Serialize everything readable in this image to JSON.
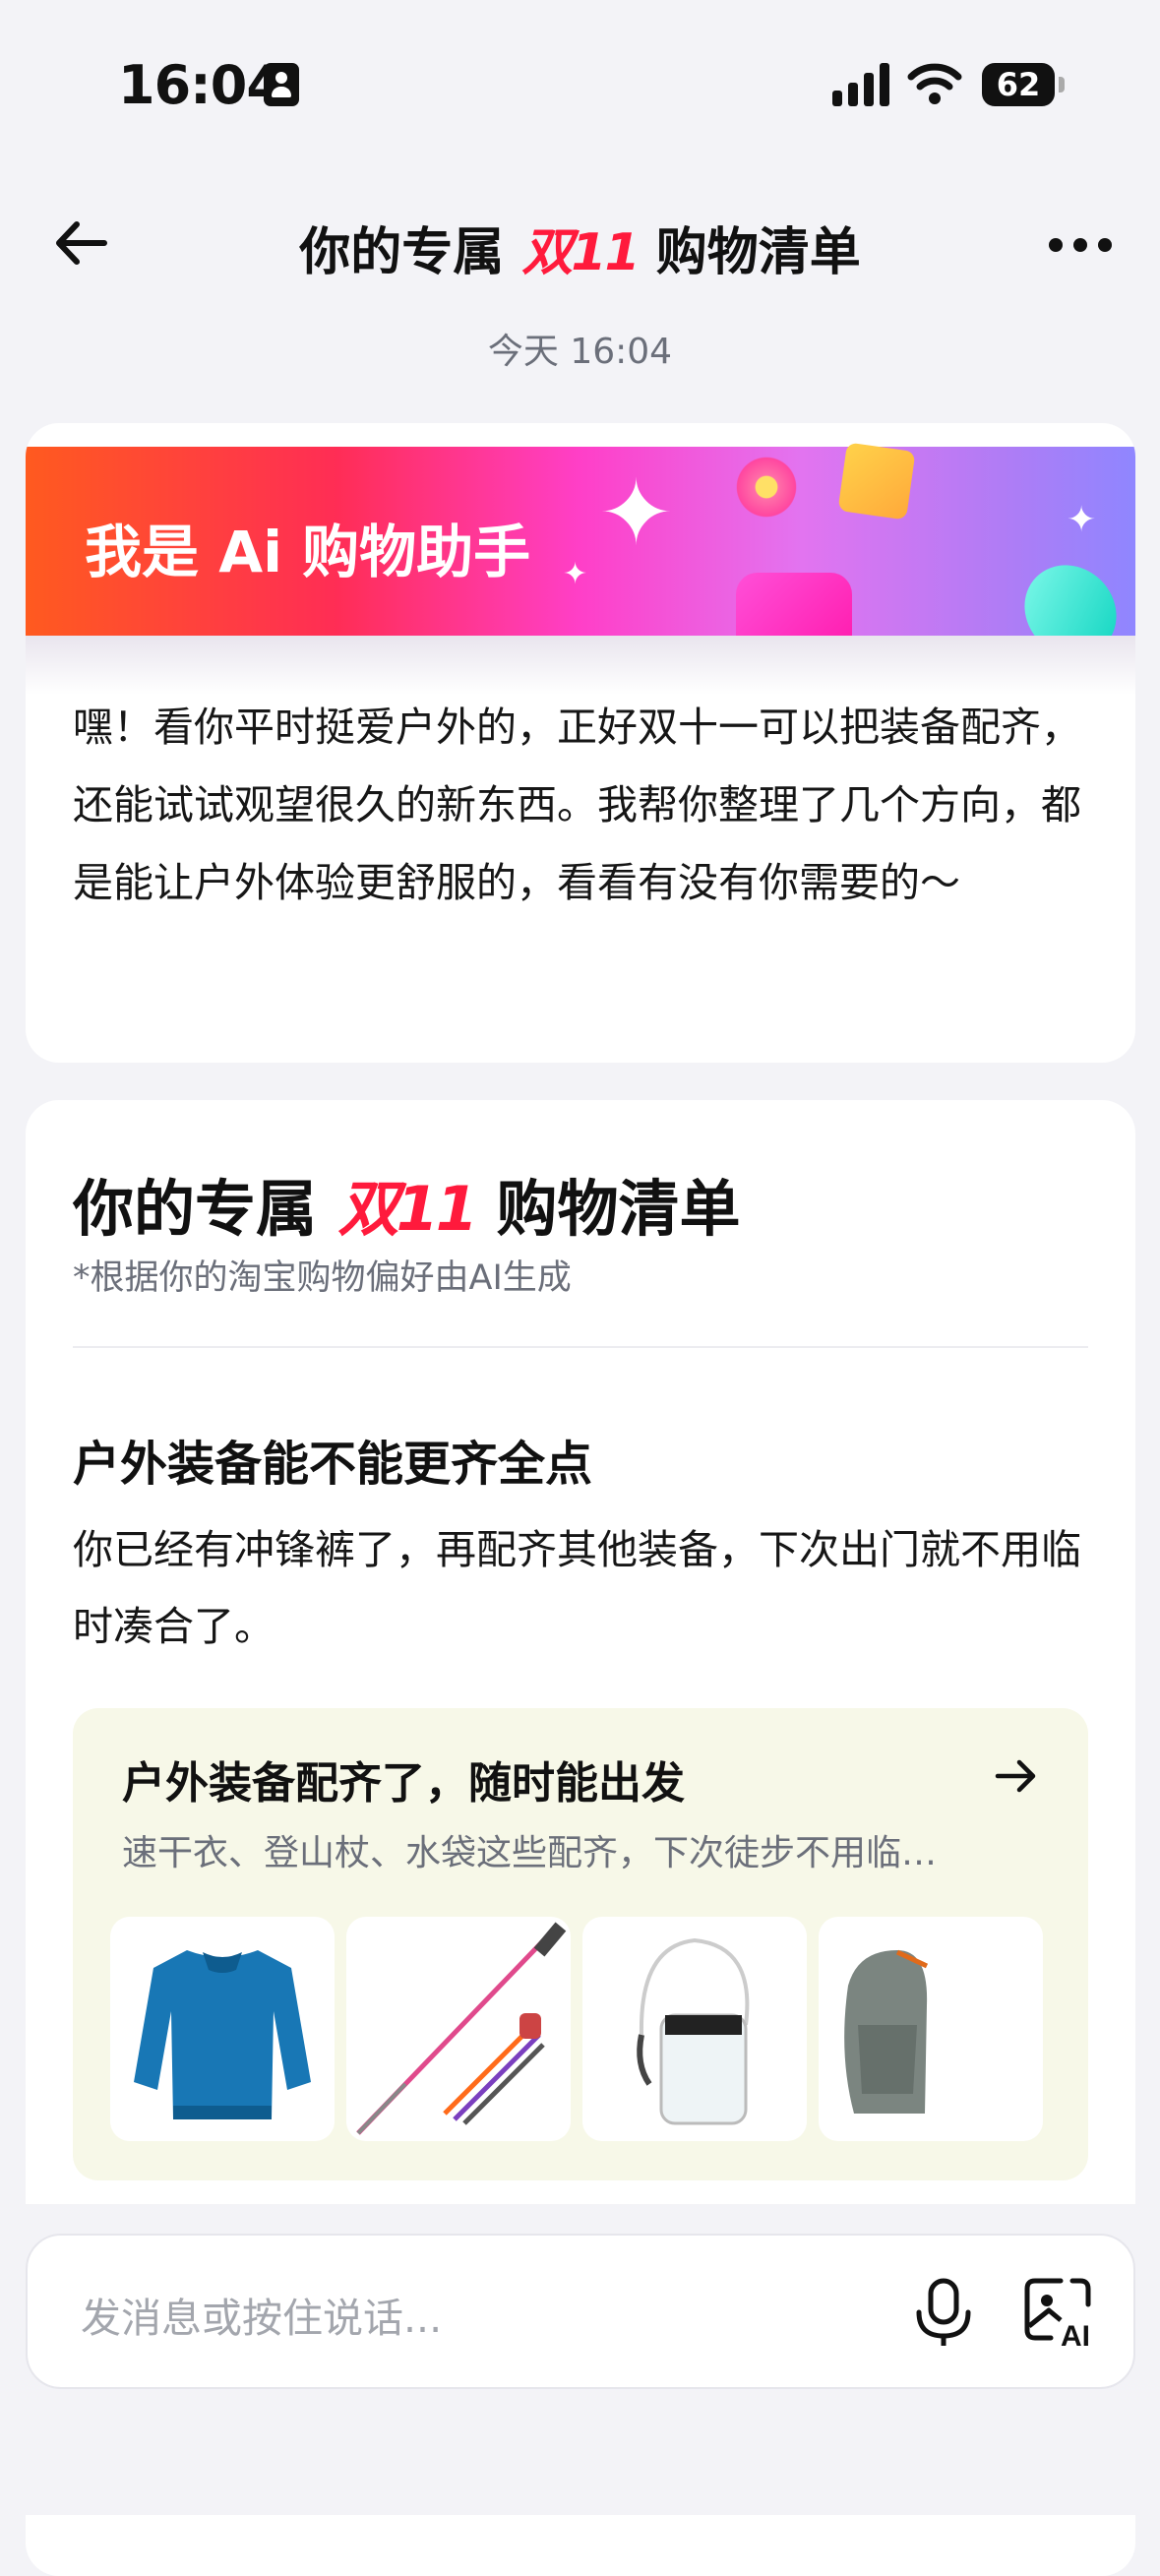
{
  "status": {
    "time": "16:04",
    "battery": "62"
  },
  "header": {
    "title_pre": "你的专属",
    "title_highlight": "双11",
    "title_post": "购物清单",
    "timestamp": "今天 16:04"
  },
  "assistant": {
    "banner": "我是 Ai 购物助手",
    "message": "嘿！看你平时挺爱户外的，正好双十一可以把装备配齐，还能试试观望很久的新东西。我帮你整理了几个方向，都是能让户外体验更舒服的，看看有没有你需要的～"
  },
  "list": {
    "title_pre": "你的专属",
    "title_highlight": "双11",
    "title_post": "购物清单",
    "subtitle": "*根据你的淘宝购物偏好由AI生成",
    "section_title": "户外装备能不能更齐全点",
    "section_desc": "你已经有冲锋裤了，再配齐其他装备，下次出门就不用临时凑合了。",
    "card": {
      "title": "户外装备配齐了，随时能出发",
      "desc": "速干衣、登山杖、水袋这些配齐，下次徒步不用临…",
      "products": [
        "blue-quick-dry-shirt",
        "trekking-pole",
        "water-bladder",
        "hiking-backpack"
      ]
    }
  },
  "input": {
    "placeholder": "发消息或按住说话..."
  },
  "colors": {
    "accent": "#ff1a3c",
    "text": "#111111",
    "muted": "#6b6f7a",
    "page_bg": "#f3f3f7"
  }
}
